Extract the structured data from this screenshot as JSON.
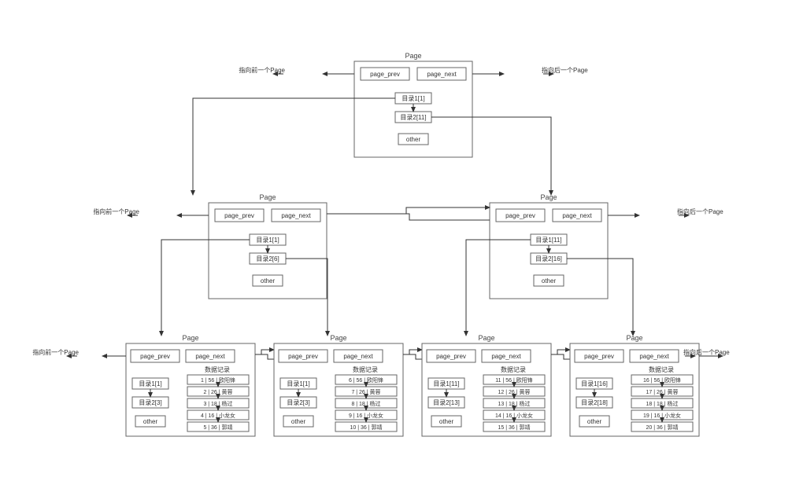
{
  "labels": {
    "page": "Page",
    "page_prev": "page_prev",
    "page_next": "page_next",
    "other": "other",
    "data_records": "数据记录",
    "ptr_prev": "指向前一个Page",
    "ptr_next": "指向后一个Page"
  },
  "top": {
    "dir1": "目录1[1]",
    "dir2": "目录2[11]"
  },
  "midL": {
    "dir1": "目录1[1]",
    "dir2": "目录2[6]"
  },
  "midR": {
    "dir1": "目录1[11]",
    "dir2": "目录2[16]"
  },
  "leaf1": {
    "dir1": "目录1[1]",
    "dir2": "目录2[3]",
    "rows": [
      "1 | 56 | 欧阳锋",
      "2 | 26 | 黄蓉",
      "3 | 18 | 杨过",
      "4 | 16 | 小龙女",
      "5 | 36 | 郭靖"
    ]
  },
  "leaf2": {
    "dir1": "目录1[1]",
    "dir2": "目录2[3]",
    "rows": [
      "6 | 56 | 欧阳锋",
      "7 | 26 | 黄蓉",
      "8 | 18 | 杨过",
      "9 | 16 | 小龙女",
      "10 | 36 | 郭靖"
    ]
  },
  "leaf3": {
    "dir1": "目录1[11]",
    "dir2": "目录2[13]",
    "rows": [
      "11 | 56 | 欧阳锋",
      "12 | 26 | 黄蓉",
      "13 | 18 | 杨过",
      "14 | 16 | 小龙女",
      "15 | 36 | 郭靖"
    ]
  },
  "leaf4": {
    "dir1": "目录1[16]",
    "dir2": "目录2[18]",
    "rows": [
      "16 | 56 | 欧阳锋",
      "17 | 26 | 黄蓉",
      "18 | 18 | 杨过",
      "19 | 16 | 小龙女",
      "20 | 36 | 郭靖"
    ]
  }
}
